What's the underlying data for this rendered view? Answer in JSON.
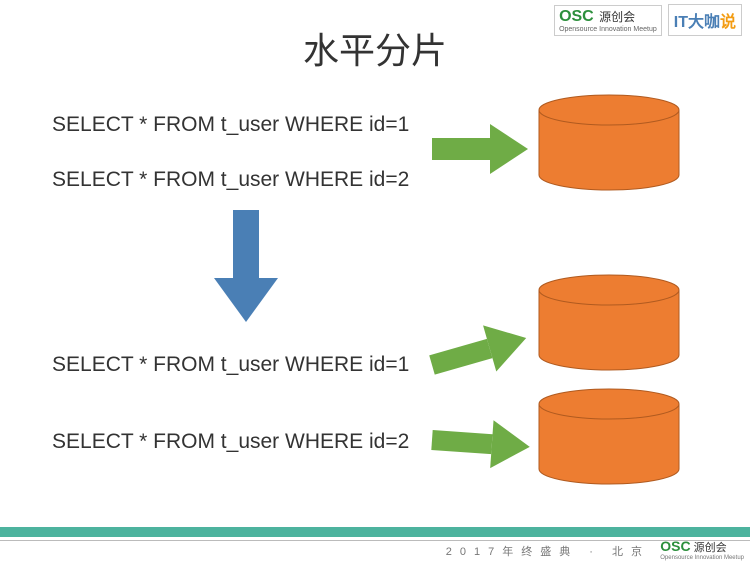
{
  "title": "水平分片",
  "sql": {
    "top1": "SELECT * FROM t_user WHERE id=1",
    "top2": "SELECT * FROM t_user WHERE id=2",
    "bot1": "SELECT * FROM t_user WHERE id=1",
    "bot2": "SELECT * FROM t_user WHERE id=2"
  },
  "logos": {
    "osc_main": "OSC",
    "osc_chi": "源创会",
    "osc_sub": "Opensource Innovation Meetup",
    "it_main": "IT大咖",
    "it_acc": "说"
  },
  "footer": {
    "text": "2017年终盛典 · 北京",
    "osc_main": "OSC",
    "osc_chi": "源创会",
    "osc_sub": "Opensource Innovation Meetup"
  },
  "colors": {
    "arrow_green": "#6fac46",
    "arrow_blue": "#4a7fb5",
    "cylinder_fill": "#ed7d31",
    "cylinder_stroke": "#b05a1f",
    "footer_bar": "#4db39e"
  },
  "chart_data": {
    "type": "diagram",
    "title": "水平分片",
    "description": "Horizontal sharding: two SQL queries originally hit one database; after sharding each query is routed to its own database shard.",
    "nodes": [
      {
        "id": "q_top_1",
        "kind": "sql",
        "text": "SELECT * FROM t_user WHERE id=1",
        "group": "before"
      },
      {
        "id": "q_top_2",
        "kind": "sql",
        "text": "SELECT * FROM t_user WHERE id=2",
        "group": "before"
      },
      {
        "id": "db_top",
        "kind": "database",
        "group": "before"
      },
      {
        "id": "q_bot_1",
        "kind": "sql",
        "text": "SELECT * FROM t_user WHERE id=1",
        "group": "after"
      },
      {
        "id": "q_bot_2",
        "kind": "sql",
        "text": "SELECT * FROM t_user WHERE id=2",
        "group": "after"
      },
      {
        "id": "db_bot_1",
        "kind": "database",
        "group": "after"
      },
      {
        "id": "db_bot_2",
        "kind": "database",
        "group": "after"
      }
    ],
    "edges": [
      {
        "from": "q_top_1",
        "to": "db_top",
        "color": "#6fac46"
      },
      {
        "from": "q_top_2",
        "to": "db_top",
        "color": "#6fac46"
      },
      {
        "from": "before",
        "to": "after",
        "color": "#4a7fb5",
        "kind": "transition"
      },
      {
        "from": "q_bot_1",
        "to": "db_bot_1",
        "color": "#6fac46"
      },
      {
        "from": "q_bot_2",
        "to": "db_bot_2",
        "color": "#6fac46"
      }
    ]
  }
}
